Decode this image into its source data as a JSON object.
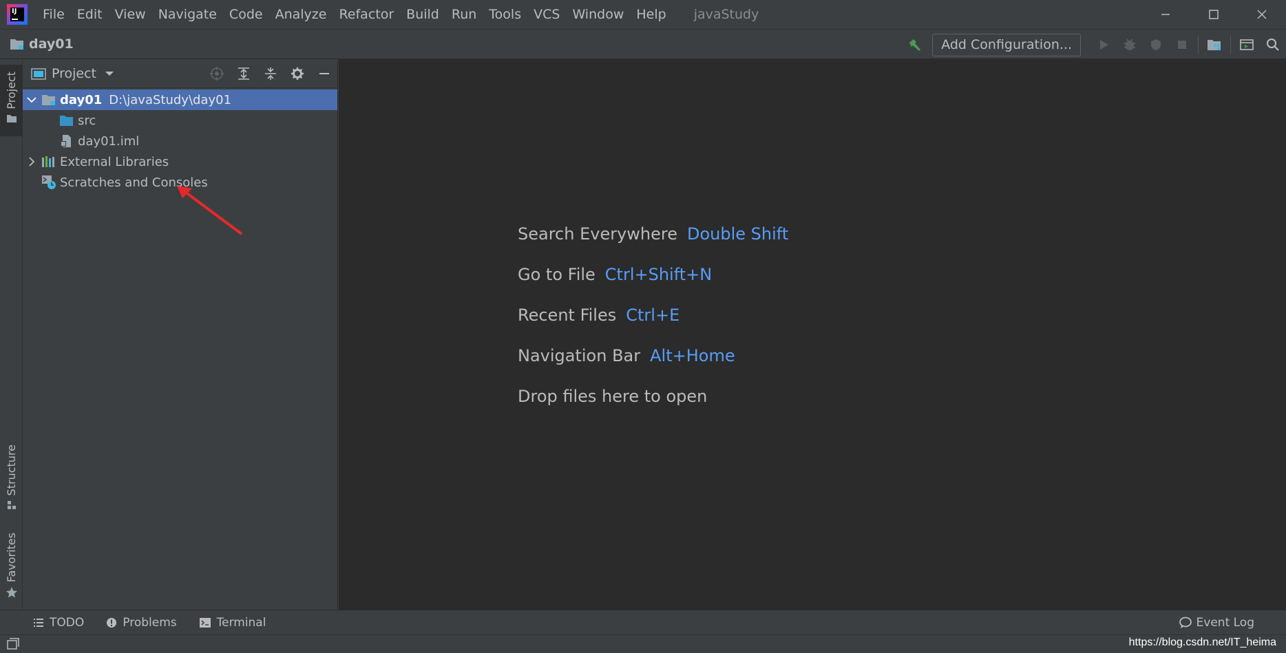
{
  "menu": {
    "items": [
      "File",
      "Edit",
      "View",
      "Navigate",
      "Code",
      "Analyze",
      "Refactor",
      "Build",
      "Run",
      "Tools",
      "VCS",
      "Window",
      "Help"
    ],
    "window_title": "javaStudy"
  },
  "navbar": {
    "crumb": "day01",
    "add_config": "Add Configuration..."
  },
  "sidebar_left": {
    "project_tab": "Project",
    "structure_tab": "Structure",
    "favorites_tab": "Favorites"
  },
  "project_panel": {
    "title": "Project",
    "tree": {
      "root_name": "day01",
      "root_path": "D:\\javaStudy\\day01",
      "src": "src",
      "iml": "day01.iml",
      "external": "External Libraries",
      "scratches": "Scratches and Consoles"
    }
  },
  "editor": {
    "hints": [
      {
        "label": "Search Everywhere",
        "key": "Double Shift"
      },
      {
        "label": "Go to File",
        "key": "Ctrl+Shift+N"
      },
      {
        "label": "Recent Files",
        "key": "Ctrl+E"
      },
      {
        "label": "Navigation Bar",
        "key": "Alt+Home"
      },
      {
        "label": "Drop files here to open",
        "key": ""
      }
    ]
  },
  "bottom": {
    "todo": "TODO",
    "problems": "Problems",
    "terminal": "Terminal",
    "event_log": "Event Log"
  },
  "watermark": "https://blog.csdn.net/IT_heima",
  "colors": {
    "background": "#3c3f41",
    "editor": "#2b2b2b",
    "selection": "#4b6eaf",
    "shortcut": "#589df6",
    "annotation": "#e5292b"
  }
}
